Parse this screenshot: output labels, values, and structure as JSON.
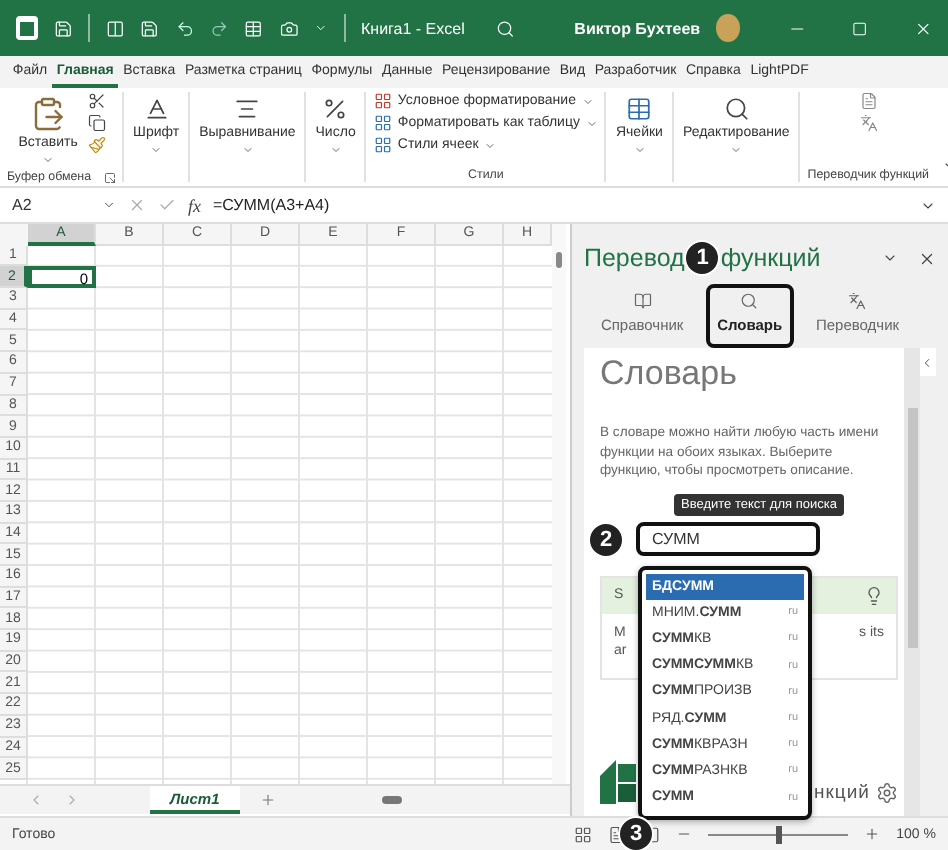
{
  "title_bar": {
    "document": "Книга1 - Excel",
    "user": "Виктор Бухтеев"
  },
  "ribbon_tabs": [
    {
      "label": "Файл",
      "selected": false
    },
    {
      "label": "Главная",
      "selected": true
    },
    {
      "label": "Вставка",
      "selected": false
    },
    {
      "label": "Разметка страниц",
      "selected": false
    },
    {
      "label": "Формулы",
      "selected": false
    },
    {
      "label": "Данные",
      "selected": false
    },
    {
      "label": "Рецензирование",
      "selected": false
    },
    {
      "label": "Вид",
      "selected": false
    },
    {
      "label": "Разработчик",
      "selected": false
    },
    {
      "label": "Справка",
      "selected": false
    },
    {
      "label": "LightPDF",
      "selected": false
    }
  ],
  "ribbon_groups": [
    {
      "kind": "clipboard",
      "label": "Буфер обмена",
      "button": "Вставить"
    },
    {
      "kind": "font",
      "button": "Шрифт"
    },
    {
      "kind": "alignment",
      "button": "Выравнивание"
    },
    {
      "kind": "number",
      "button": "Число"
    },
    {
      "kind": "styles",
      "label": "Стили",
      "items": [
        "Условное форматирование",
        "Форматировать как таблицу",
        "Стили ячеек"
      ]
    },
    {
      "kind": "cells",
      "button": "Ячейки"
    },
    {
      "kind": "editing",
      "button": "Редактирование"
    },
    {
      "kind": "translator",
      "label": "Переводчик функций"
    }
  ],
  "formula_bar": {
    "name_box": "A2",
    "function_label": "fx",
    "formula": "=СУММ(A3+A4)"
  },
  "sheet": {
    "columns": [
      {
        "label": "A",
        "selected": true
      },
      {
        "label": "B",
        "selected": false
      },
      {
        "label": "C",
        "selected": false
      },
      {
        "label": "D",
        "selected": false
      },
      {
        "label": "E",
        "selected": false
      },
      {
        "label": "F",
        "selected": false
      },
      {
        "label": "G",
        "selected": false
      },
      {
        "label": "H",
        "selected": false
      }
    ],
    "rows": [
      {
        "label": "1",
        "selected": false
      },
      {
        "label": "2",
        "selected": true,
        "cells": [
          "0"
        ]
      },
      {
        "label": "3",
        "selected": false
      },
      {
        "label": "4",
        "selected": false
      },
      {
        "label": "5",
        "selected": false
      },
      {
        "label": "6",
        "selected": false
      },
      {
        "label": "7",
        "selected": false
      },
      {
        "label": "8",
        "selected": false
      },
      {
        "label": "9",
        "selected": false
      },
      {
        "label": "10",
        "selected": false
      },
      {
        "label": "11",
        "selected": false
      },
      {
        "label": "12",
        "selected": false
      },
      {
        "label": "13",
        "selected": false
      },
      {
        "label": "14",
        "selected": false
      },
      {
        "label": "15",
        "selected": false
      },
      {
        "label": "16",
        "selected": false
      },
      {
        "label": "17",
        "selected": false
      },
      {
        "label": "18",
        "selected": false
      },
      {
        "label": "19",
        "selected": false
      },
      {
        "label": "20",
        "selected": false
      },
      {
        "label": "21",
        "selected": false
      },
      {
        "label": "22",
        "selected": false
      },
      {
        "label": "23",
        "selected": false
      },
      {
        "label": "24",
        "selected": false
      },
      {
        "label": "25",
        "selected": false
      }
    ]
  },
  "sheet_tabs": [
    {
      "label": "Лист1",
      "selected": true
    }
  ],
  "task_pane": {
    "title_parts": [
      "Перевод",
      "функций"
    ],
    "tabs_badge": "1",
    "search_badge": "2",
    "footer_badge": "3",
    "tabs": [
      {
        "label": "Справочник",
        "kind": "book",
        "selected": false
      },
      {
        "label": "Словарь",
        "kind": "search",
        "selected": true
      },
      {
        "label": "Переводчик",
        "kind": "translate",
        "selected": false
      }
    ],
    "heading": "Словарь",
    "description": "В словаре можно найти любую часть имени функции на обоих языках. Выберите функцию, чтобы просмотреть описание.",
    "tooltip": "Введите текст для поиска",
    "search_value": "СУММ",
    "card": {
      "title": "S",
      "body_left": "M",
      "body_left_2": "ar",
      "body_right": "s its"
    },
    "suggestions": [
      {
        "label": "БДСУММ",
        "selected": true
      },
      {
        "label": "МНИМ.**СУММ**",
        "lang": "ru",
        "selected": false
      },
      {
        "label": "**СУММ**КВ",
        "lang": "ru",
        "selected": false
      },
      {
        "label": "**СУММСУММ**КВ",
        "lang": "ru",
        "selected": false
      },
      {
        "label": "**СУММ**ПРОИЗВ",
        "lang": "ru",
        "selected": false
      },
      {
        "label": "РЯД.**СУММ**",
        "lang": "ru",
        "selected": false
      },
      {
        "label": "**СУММ**КВРАЗН",
        "lang": "ru",
        "selected": false
      },
      {
        "label": "**СУММ**РАЗНКВ",
        "lang": "ru",
        "selected": false
      },
      {
        "label": "**СУММ**",
        "lang": "ru",
        "selected": false
      }
    ],
    "footer_text": "нкций"
  },
  "status_bar": {
    "status": "Готово",
    "zoom": "100 %",
    "zoom_level": {
      "level": 0.5
    }
  }
}
